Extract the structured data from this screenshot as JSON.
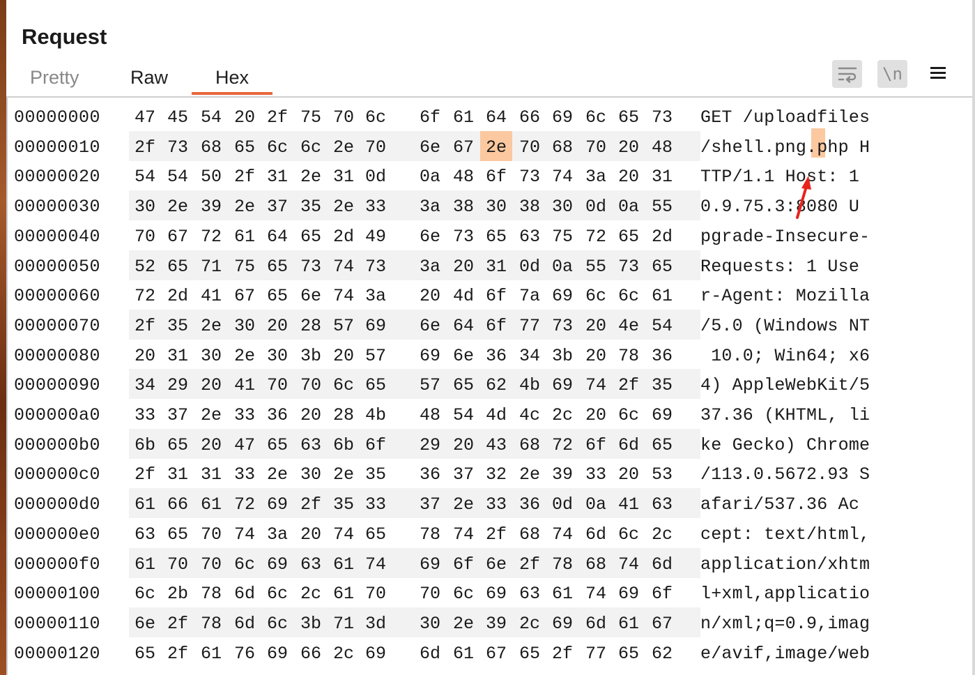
{
  "panel": {
    "title": "Request"
  },
  "tabs": [
    {
      "label": "Pretty",
      "active": false
    },
    {
      "label": "Raw",
      "active": false
    },
    {
      "label": "Hex",
      "active": true
    }
  ],
  "toolbar": {
    "wrap_icon": "text-wrap-icon",
    "newline_label": "\\n",
    "menu_icon": "hamburger-menu-icon"
  },
  "colors": {
    "accent": "#e8663a",
    "highlight": "#fbc8a0",
    "row_alt": "#f2f2f2"
  },
  "hex_rows": [
    {
      "offset": "00000000",
      "bytes": [
        "47",
        "45",
        "54",
        "20",
        "2f",
        "75",
        "70",
        "6c",
        "6f",
        "61",
        "64",
        "66",
        "69",
        "6c",
        "65",
        "73"
      ],
      "ascii": "GET /uploadfiles"
    },
    {
      "offset": "00000010",
      "bytes": [
        "2f",
        "73",
        "68",
        "65",
        "6c",
        "6c",
        "2e",
        "70",
        "6e",
        "67",
        "2e",
        "70",
        "68",
        "70",
        "20",
        "48"
      ],
      "ascii": "/shell.png.php H"
    },
    {
      "offset": "00000020",
      "bytes": [
        "54",
        "54",
        "50",
        "2f",
        "31",
        "2e",
        "31",
        "0d",
        "0a",
        "48",
        "6f",
        "73",
        "74",
        "3a",
        "20",
        "31"
      ],
      "ascii": "TTP/1.1 Host: 1"
    },
    {
      "offset": "00000030",
      "bytes": [
        "30",
        "2e",
        "39",
        "2e",
        "37",
        "35",
        "2e",
        "33",
        "3a",
        "38",
        "30",
        "38",
        "30",
        "0d",
        "0a",
        "55"
      ],
      "ascii": "0.9.75.3:8080 U"
    },
    {
      "offset": "00000040",
      "bytes": [
        "70",
        "67",
        "72",
        "61",
        "64",
        "65",
        "2d",
        "49",
        "6e",
        "73",
        "65",
        "63",
        "75",
        "72",
        "65",
        "2d"
      ],
      "ascii": "pgrade-Insecure-"
    },
    {
      "offset": "00000050",
      "bytes": [
        "52",
        "65",
        "71",
        "75",
        "65",
        "73",
        "74",
        "73",
        "3a",
        "20",
        "31",
        "0d",
        "0a",
        "55",
        "73",
        "65"
      ],
      "ascii": "Requests: 1 Use"
    },
    {
      "offset": "00000060",
      "bytes": [
        "72",
        "2d",
        "41",
        "67",
        "65",
        "6e",
        "74",
        "3a",
        "20",
        "4d",
        "6f",
        "7a",
        "69",
        "6c",
        "6c",
        "61"
      ],
      "ascii": "r-Agent: Mozilla"
    },
    {
      "offset": "00000070",
      "bytes": [
        "2f",
        "35",
        "2e",
        "30",
        "20",
        "28",
        "57",
        "69",
        "6e",
        "64",
        "6f",
        "77",
        "73",
        "20",
        "4e",
        "54"
      ],
      "ascii": "/5.0 (Windows NT"
    },
    {
      "offset": "00000080",
      "bytes": [
        "20",
        "31",
        "30",
        "2e",
        "30",
        "3b",
        "20",
        "57",
        "69",
        "6e",
        "36",
        "34",
        "3b",
        "20",
        "78",
        "36"
      ],
      "ascii": " 10.0; Win64; x6"
    },
    {
      "offset": "00000090",
      "bytes": [
        "34",
        "29",
        "20",
        "41",
        "70",
        "70",
        "6c",
        "65",
        "57",
        "65",
        "62",
        "4b",
        "69",
        "74",
        "2f",
        "35"
      ],
      "ascii": "4) AppleWebKit/5"
    },
    {
      "offset": "000000a0",
      "bytes": [
        "33",
        "37",
        "2e",
        "33",
        "36",
        "20",
        "28",
        "4b",
        "48",
        "54",
        "4d",
        "4c",
        "2c",
        "20",
        "6c",
        "69"
      ],
      "ascii": "37.36 (KHTML, li"
    },
    {
      "offset": "000000b0",
      "bytes": [
        "6b",
        "65",
        "20",
        "47",
        "65",
        "63",
        "6b",
        "6f",
        "29",
        "20",
        "43",
        "68",
        "72",
        "6f",
        "6d",
        "65"
      ],
      "ascii": "ke Gecko) Chrome"
    },
    {
      "offset": "000000c0",
      "bytes": [
        "2f",
        "31",
        "31",
        "33",
        "2e",
        "30",
        "2e",
        "35",
        "36",
        "37",
        "32",
        "2e",
        "39",
        "33",
        "20",
        "53"
      ],
      "ascii": "/113.0.5672.93 S"
    },
    {
      "offset": "000000d0",
      "bytes": [
        "61",
        "66",
        "61",
        "72",
        "69",
        "2f",
        "35",
        "33",
        "37",
        "2e",
        "33",
        "36",
        "0d",
        "0a",
        "41",
        "63"
      ],
      "ascii": "afari/537.36 Ac"
    },
    {
      "offset": "000000e0",
      "bytes": [
        "63",
        "65",
        "70",
        "74",
        "3a",
        "20",
        "74",
        "65",
        "78",
        "74",
        "2f",
        "68",
        "74",
        "6d",
        "6c",
        "2c"
      ],
      "ascii": "cept: text/html,"
    },
    {
      "offset": "000000f0",
      "bytes": [
        "61",
        "70",
        "70",
        "6c",
        "69",
        "63",
        "61",
        "74",
        "69",
        "6f",
        "6e",
        "2f",
        "78",
        "68",
        "74",
        "6d"
      ],
      "ascii": "application/xhtm"
    },
    {
      "offset": "00000100",
      "bytes": [
        "6c",
        "2b",
        "78",
        "6d",
        "6c",
        "2c",
        "61",
        "70",
        "70",
        "6c",
        "69",
        "63",
        "61",
        "74",
        "69",
        "6f"
      ],
      "ascii": "l+xml,applicatio"
    },
    {
      "offset": "00000110",
      "bytes": [
        "6e",
        "2f",
        "78",
        "6d",
        "6c",
        "3b",
        "71",
        "3d",
        "30",
        "2e",
        "39",
        "2c",
        "69",
        "6d",
        "61",
        "67"
      ],
      "ascii": "n/xml;q=0.9,imag"
    },
    {
      "offset": "00000120",
      "bytes": [
        "65",
        "2f",
        "61",
        "76",
        "69",
        "66",
        "2c",
        "69",
        "6d",
        "61",
        "67",
        "65",
        "2f",
        "77",
        "65",
        "62"
      ],
      "ascii": "e/avif,image/web"
    }
  ]
}
